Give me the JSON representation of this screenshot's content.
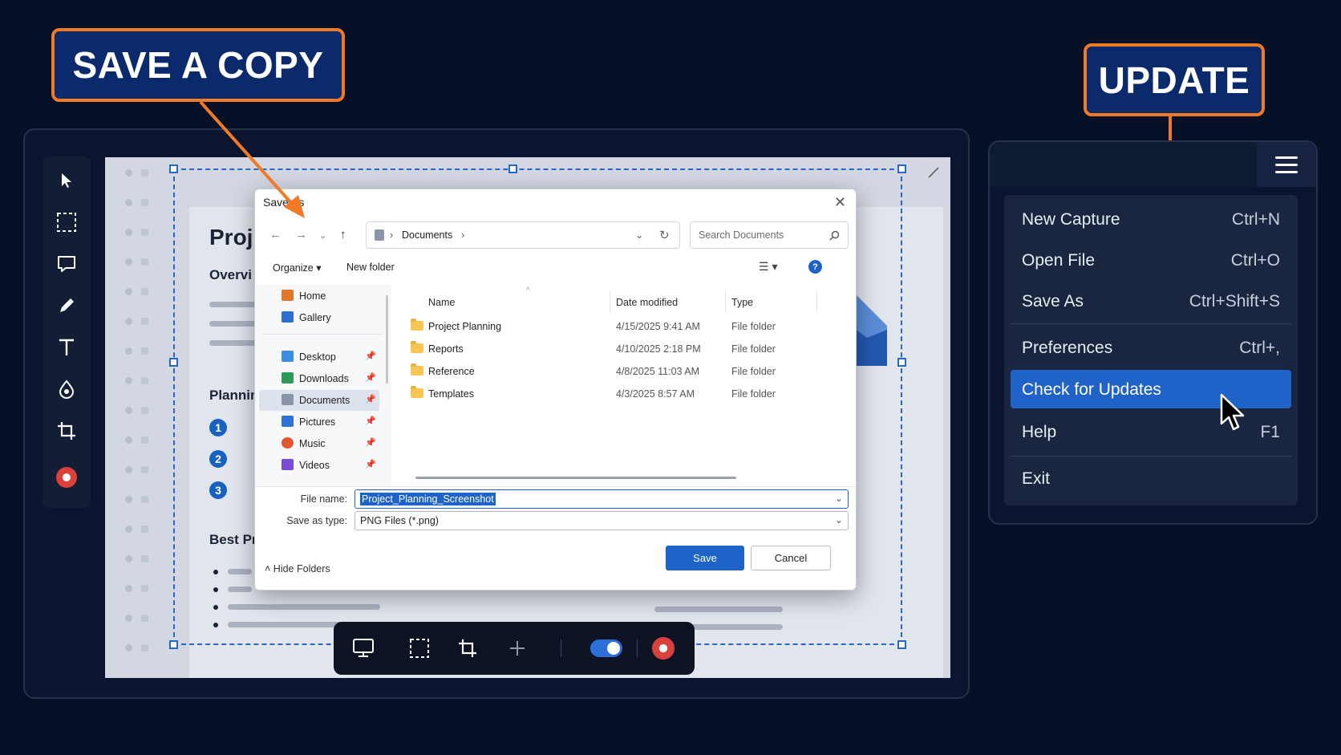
{
  "callouts": {
    "save_copy": "SAVE A COPY",
    "update": "UPDATE"
  },
  "document": {
    "title_partial": "Proj",
    "overview_partial": "Overvi",
    "planning_partial": "Plannin",
    "best_partial": "Best Pr",
    "steps": [
      "1",
      "2",
      "3"
    ]
  },
  "dialog": {
    "title": "Save As",
    "close_icon": "close-icon",
    "breadcrumb": "Documents",
    "search_placeholder": "Search Documents",
    "organize": "Organize",
    "new_folder": "New folder",
    "help": "?",
    "nav_items": [
      {
        "label": "Home",
        "icon": "home-icon",
        "color": "#e0772c",
        "pinned": false
      },
      {
        "label": "Gallery",
        "icon": "gallery-icon",
        "color": "#2d6fcf",
        "pinned": false
      },
      {
        "label": "Desktop",
        "icon": "desktop-icon",
        "color": "#3a8de0",
        "pinned": true
      },
      {
        "label": "Downloads",
        "icon": "download-icon",
        "color": "#2e9a57",
        "pinned": true
      },
      {
        "label": "Documents",
        "icon": "documents-icon",
        "color": "#8a95a8",
        "pinned": true
      },
      {
        "label": "Pictures",
        "icon": "pictures-icon",
        "color": "#2f72d6",
        "pinned": true
      },
      {
        "label": "Music",
        "icon": "music-icon",
        "color": "#e0592c",
        "pinned": true
      },
      {
        "label": "Videos",
        "icon": "videos-icon",
        "color": "#7a4bd6",
        "pinned": true
      }
    ],
    "columns": {
      "name": "Name",
      "date": "Date modified",
      "type": "Type"
    },
    "files": [
      {
        "name": "Project Planning",
        "date": "4/15/2025 9:41 AM",
        "type": "File folder"
      },
      {
        "name": "Reports",
        "date": "4/10/2025 2:18 PM",
        "type": "File folder"
      },
      {
        "name": "Reference",
        "date": "4/8/2025 11:03 AM",
        "type": "File folder"
      },
      {
        "name": "Templates",
        "date": "4/3/2025 8:57 AM",
        "type": "File folder"
      }
    ],
    "file_name_label": "File name:",
    "file_name_value": "Project_Planning_Screenshot",
    "save_type_label": "Save as type:",
    "save_type_value": "PNG Files (*.png)",
    "hide_folders": "Hide Folders",
    "save_button": "Save",
    "cancel_button": "Cancel"
  },
  "menu": {
    "items": [
      {
        "label": "New Capture",
        "shortcut": "Ctrl+N"
      },
      {
        "label": "Open File",
        "shortcut": "Ctrl+O"
      },
      {
        "label": "Save As",
        "shortcut": "Ctrl+Shift+S"
      },
      {
        "label": "Preferences",
        "shortcut": "Ctrl+,"
      },
      {
        "label": "Check for Updates",
        "shortcut": ""
      },
      {
        "label": "Help",
        "shortcut": "F1"
      },
      {
        "label": "Exit",
        "shortcut": ""
      }
    ],
    "highlighted": "Check for Updates"
  },
  "colors": {
    "accent": "#1f63c9",
    "callout_border": "#f07a25",
    "callout_fill": "#0b2a6b",
    "record": "#d9413a"
  }
}
